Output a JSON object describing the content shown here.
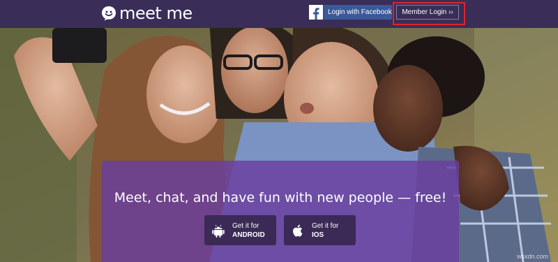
{
  "header": {
    "logo_text": "meet me",
    "facebook_login_label": "Login with Facebook",
    "member_login_label": "Member Login ››"
  },
  "hero": {
    "tagline": "Meet, chat, and have fun with new people — free!",
    "android": {
      "line1": "Get it for",
      "line2": "ANDROID"
    },
    "ios": {
      "line1": "Get it for",
      "line2": "IOS"
    }
  },
  "watermark": "wsxdn.com",
  "colors": {
    "topbar": "#3a2d57",
    "card": "#6a3ea0",
    "facebook": "#3b5998",
    "highlight": "#e0242a"
  },
  "icons": [
    "smiley-logo-icon",
    "facebook-icon",
    "android-icon",
    "apple-icon"
  ]
}
